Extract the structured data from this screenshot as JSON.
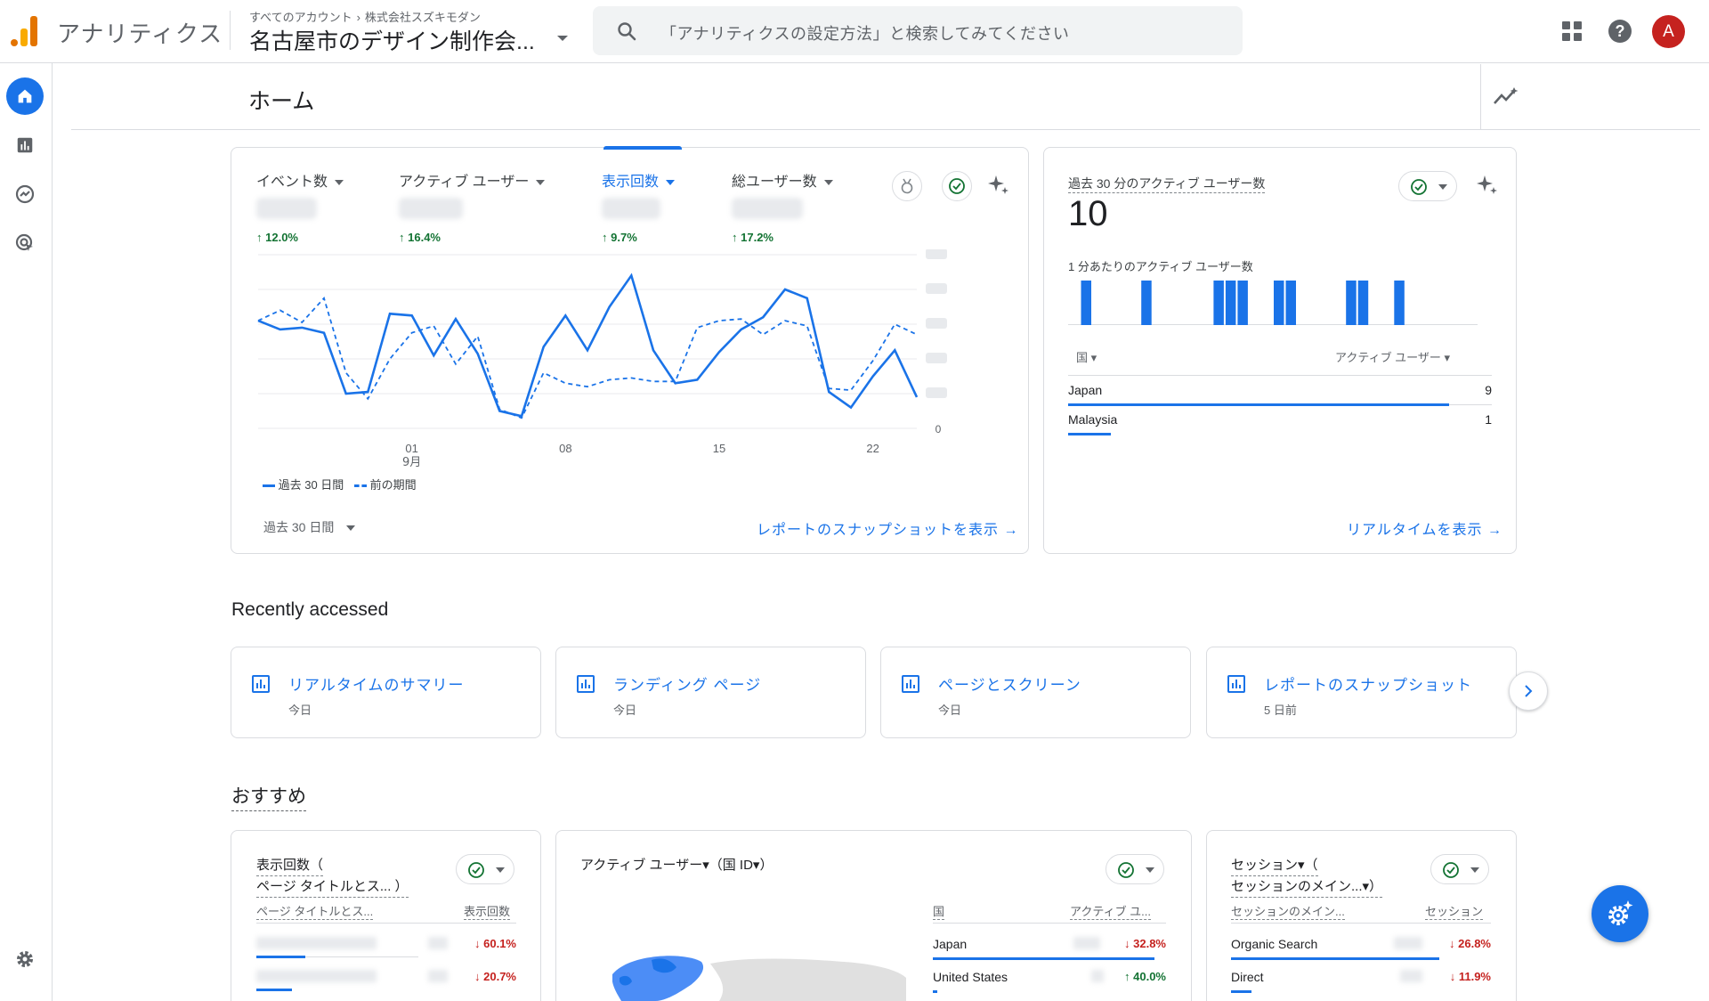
{
  "topbar": {
    "app_title": "アナリティクス",
    "breadcrumb_all_accounts": "すべてのアカウント",
    "breadcrumb_account": "株式会社スズキモダン",
    "property_name": "名古屋市のデザイン制作会...",
    "search_placeholder": "「アナリティクスの設定方法」と検索してみてください",
    "avatar_letter": "A"
  },
  "page": {
    "title": "ホーム"
  },
  "overview_card": {
    "metrics": [
      {
        "label": "イベント数",
        "delta": "12.0%"
      },
      {
        "label": "アクティブ ユーザー",
        "delta": "16.4%"
      },
      {
        "label": "表示回数",
        "delta": "9.7%"
      },
      {
        "label": "総ユーザー数",
        "delta": "17.2%"
      }
    ],
    "chart_data": {
      "type": "line",
      "x_tick_labels": [
        {
          "label": "01",
          "sub": "9月"
        },
        {
          "label": "08",
          "sub": ""
        },
        {
          "label": "15",
          "sub": ""
        },
        {
          "label": "22",
          "sub": ""
        }
      ],
      "y_tick_last": "0",
      "legend": [
        {
          "name": "過去 30 日間",
          "style": "solid",
          "color": "#1a73e8"
        },
        {
          "name": "前の期間",
          "style": "dashed",
          "color": "#1a73e8"
        }
      ],
      "series": [
        {
          "name": "過去 30 日間",
          "values": [
            62,
            57,
            58,
            55,
            20,
            21,
            66,
            65,
            42,
            63,
            43,
            10,
            7,
            47,
            65,
            45,
            70,
            88,
            45,
            26,
            28,
            44,
            57,
            64,
            80,
            75,
            21,
            12,
            30,
            45,
            18
          ]
        },
        {
          "name": "前の期間",
          "values": [
            62,
            68,
            61,
            75,
            32,
            17,
            40,
            55,
            59,
            37,
            53,
            11,
            6,
            32,
            26,
            24,
            28,
            29,
            27,
            27,
            58,
            62,
            63,
            54,
            62,
            59,
            23,
            22,
            39,
            60,
            54
          ]
        }
      ],
      "ylim": [
        0,
        100
      ]
    },
    "date_range": "過去 30 日間",
    "snapshot_link": "レポートのスナップショットを表示"
  },
  "realtime_card": {
    "title": "過去 30 分のアクティブ ユーザー数",
    "value": "10",
    "per_minute_label": "1 分あたりのアクティブ ユーザー数",
    "bars": [
      0,
      1,
      0,
      0,
      0,
      0,
      1,
      0,
      0,
      0,
      0,
      0,
      1,
      1,
      1,
      0,
      0,
      1,
      1,
      0,
      0,
      0,
      0,
      1,
      1,
      0,
      0,
      1,
      0,
      0,
      0,
      0,
      0,
      0
    ],
    "col_country": "国",
    "col_users": "アクティブ ユーザー",
    "rows": [
      {
        "country": "Japan",
        "value": "9",
        "share": 0.9
      },
      {
        "country": "Malaysia",
        "value": "1",
        "share": 0.1
      }
    ],
    "link": "リアルタイムを表示"
  },
  "recent": {
    "title": "Recently accessed",
    "items": [
      {
        "title": "リアルタイムのサマリー",
        "sub": "今日"
      },
      {
        "title": "ランディング ページ",
        "sub": "今日"
      },
      {
        "title": "ページとスクリーン",
        "sub": "今日"
      },
      {
        "title": "レポートのスナップショット",
        "sub": "5 日前"
      }
    ]
  },
  "recommended": {
    "title": "おすすめ",
    "card1": {
      "title_line1": "表示回数（",
      "title_line2": "ページ タイトルとス... ）",
      "col1": "ページ タイトルとス...",
      "col2": "表示回数",
      "rows": [
        {
          "delta": "60.1%",
          "share": 0.3
        },
        {
          "delta": "20.7%",
          "share": 0.22
        }
      ]
    },
    "card2": {
      "title": "アクティブ ユーザー▾（国 ID▾）",
      "col1": "国",
      "col2": "アクティブ ユ...",
      "rows": [
        {
          "country": "Japan",
          "delta": "32.8%",
          "dir": "down",
          "share": 0.95
        },
        {
          "country": "United States",
          "delta": "40.0%",
          "dir": "up",
          "share": 0.02
        }
      ]
    },
    "card3": {
      "title_line1": "セッション▾（",
      "title_line2": "セッションのメイン...▾）",
      "col1": "セッションのメイン...",
      "col2": "セッション",
      "rows": [
        {
          "source": "Organic Search",
          "delta": "26.8%",
          "share": 0.8
        },
        {
          "source": "Direct",
          "delta": "11.9%",
          "share": 0.08
        }
      ]
    }
  }
}
